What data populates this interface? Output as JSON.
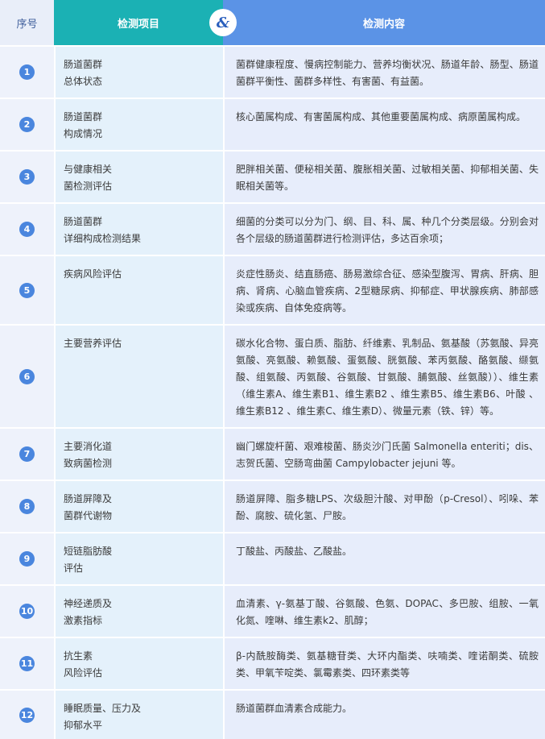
{
  "header": {
    "seq": "序号",
    "item": "检测项目",
    "amp": "&",
    "content": "检测内容"
  },
  "rows": [
    {
      "num": "1",
      "item": "肠道菌群\n总体状态",
      "content": "菌群健康程度、慢病控制能力、营养均衡状况、肠道年龄、肠型、肠道菌群平衡性、菌群多样性、有害菌、有益菌。"
    },
    {
      "num": "2",
      "item": "肠道菌群\n构成情况",
      "content": "核心菌属构成、有害菌属构成、其他重要菌属构成、病原菌属构成。"
    },
    {
      "num": "3",
      "item": "与健康相关\n菌检测评估",
      "content": "肥胖相关菌、便秘相关菌、腹胀相关菌、过敏相关菌、抑郁相关菌、失眠相关菌等。"
    },
    {
      "num": "4",
      "item": "肠道菌群\n详细构成检测结果",
      "content": "细菌的分类可以分为门、纲、目、科、属、种几个分类层级。分别会对各个层级的肠道菌群进行检测评估，多达百余项；"
    },
    {
      "num": "5",
      "item": "疾病风险评估",
      "content": "炎症性肠炎、结直肠癌、肠易激综合征、感染型腹泻、胃病、肝病、胆病、肾病、心脑血管疾病、2型糖尿病、抑郁症、甲状腺疾病、肺部感染或疾病、自体免疫病等。"
    },
    {
      "num": "6",
      "item": "主要营养评估",
      "content": "碳水化合物、蛋白质、脂肪、纤维素、乳制品、氨基酸（苏氨酸、异亮氨酸、亮氨酸、赖氨酸、蛋氨酸、胱氨酸、苯丙氨酸、酪氨酸、缬氨酸、组氨酸、丙氨酸、谷氨酸、甘氨酸、脯氨酸、丝氨酸））、维生素（维生素A、维生素B1、维生素B2 、维生素B5、维生素B6、叶酸 、维生素B12 、维生素C、维生素D）、微量元素（铁、锌）等。"
    },
    {
      "num": "7",
      "item": "主要消化道\n致病菌检测",
      "content": "幽门螺旋杆菌、艰难梭菌、肠炎沙门氏菌 Salmonella enteriti；dis、志贺氏菌、空肠弯曲菌 Campylobacter jejuni 等。"
    },
    {
      "num": "8",
      "item": "肠道屏障及\n菌群代谢物",
      "content": "肠道屏障、脂多糖LPS、次级胆汁酸、对甲酚（p-Cresol）、吲哚、苯酚、腐胺、硫化氢、尸胺。"
    },
    {
      "num": "9",
      "item": "短链脂肪酸\n评估",
      "content": "丁酸盐、丙酸盐、乙酸盐。"
    },
    {
      "num": "10",
      "item": "神经递质及\n激素指标",
      "content": "血清素、γ-氨基丁酸、谷氨酸、色氨、DOPAC、多巴胺、组胺、一氧化氮、喹啉、维生素k2、肌醇；"
    },
    {
      "num": "11",
      "item": "抗生素\n风险评估",
      "content": "β-内酰胺酶类、氨基糖苷类、大环内酯类、呋喃类、喹诺酮类、硫胺类、甲氧苄啶类、氯霉素类、四环素类等"
    },
    {
      "num": "12",
      "item": "睡眠质量、压力及\n抑郁水平",
      "content": "肠道菌群血清素合成能力。"
    }
  ]
}
